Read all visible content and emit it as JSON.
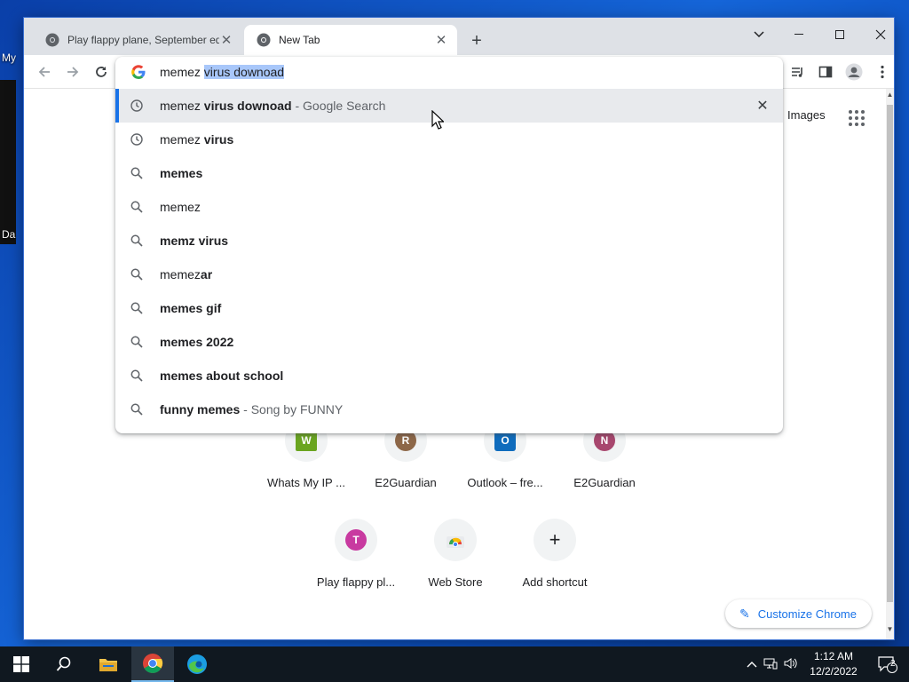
{
  "desktop": {
    "icon_labels": [
      "My",
      "Da"
    ]
  },
  "tabs": [
    {
      "title": "Play flappy plane, September edi",
      "active": false
    },
    {
      "title": "New Tab",
      "active": true
    }
  ],
  "omnibox": {
    "typed": "memez ",
    "autocomplete": "virus downoad",
    "suggestions": [
      {
        "icon": "history-icon",
        "normal": "memez ",
        "bold": "virus downoad",
        "description": " - Google Search",
        "highlighted": true
      },
      {
        "icon": "history-icon",
        "normal": "memez ",
        "bold": "virus",
        "description": ""
      },
      {
        "icon": "search-icon",
        "normal": "",
        "bold": "memes",
        "description": ""
      },
      {
        "icon": "search-icon",
        "normal": "memez",
        "bold": "",
        "description": ""
      },
      {
        "icon": "search-icon",
        "normal": "",
        "bold": "memz virus",
        "description": ""
      },
      {
        "icon": "search-icon",
        "normal": "memez",
        "bold": "ar",
        "description": ""
      },
      {
        "icon": "search-icon",
        "normal": "",
        "bold": "memes gif",
        "description": ""
      },
      {
        "icon": "search-icon",
        "normal": "",
        "bold": "memes 2022",
        "description": ""
      },
      {
        "icon": "search-icon",
        "normal": "",
        "bold": "memes about school",
        "description": ""
      },
      {
        "icon": "search-icon",
        "normal": "",
        "bold": "funny memes",
        "description": " - Song by FUNNY"
      }
    ]
  },
  "ntp": {
    "images_link": "Images",
    "shortcuts_row1": [
      {
        "label": "Whats My IP ...",
        "letter": "W",
        "color": "#6aa520"
      },
      {
        "label": "E2Guardian",
        "letter": "R",
        "color": "#8d6748"
      },
      {
        "label": "Outlook – fre...",
        "letter": "O",
        "color": "#0f6cbd"
      },
      {
        "label": "E2Guardian",
        "letter": "N",
        "color": "#a8476e"
      }
    ],
    "shortcuts_row2": [
      {
        "label": "Play flappy pl...",
        "letter": "T",
        "color": "#c83aa0"
      },
      {
        "label": "Web Store",
        "letter": "",
        "color": "#e8eaed"
      },
      {
        "label": "Add shortcut",
        "letter": "+",
        "color": "#f1f3f4"
      }
    ],
    "customize_label": "Customize Chrome"
  },
  "taskbar": {
    "time": "1:12 AM",
    "date": "12/2/2022",
    "notification_count": "2"
  },
  "colors": {
    "accent": "#1a73e8",
    "taskbar": "#101820",
    "desktop": "#1565d8"
  }
}
